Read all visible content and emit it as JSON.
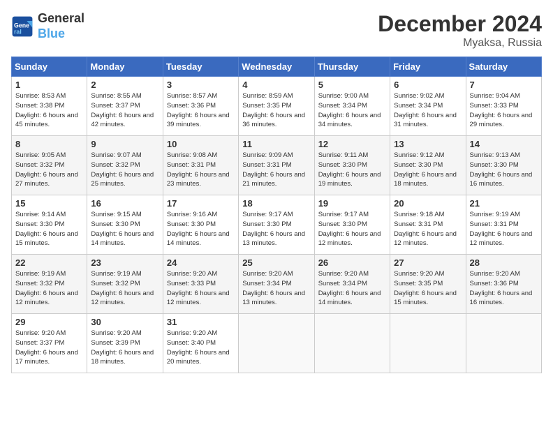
{
  "header": {
    "logo_line1": "General",
    "logo_line2": "Blue",
    "month": "December 2024",
    "location": "Myaksa, Russia"
  },
  "weekdays": [
    "Sunday",
    "Monday",
    "Tuesday",
    "Wednesday",
    "Thursday",
    "Friday",
    "Saturday"
  ],
  "weeks": [
    [
      {
        "day": "1",
        "sunrise": "Sunrise: 8:53 AM",
        "sunset": "Sunset: 3:38 PM",
        "daylight": "Daylight: 6 hours and 45 minutes."
      },
      {
        "day": "2",
        "sunrise": "Sunrise: 8:55 AM",
        "sunset": "Sunset: 3:37 PM",
        "daylight": "Daylight: 6 hours and 42 minutes."
      },
      {
        "day": "3",
        "sunrise": "Sunrise: 8:57 AM",
        "sunset": "Sunset: 3:36 PM",
        "daylight": "Daylight: 6 hours and 39 minutes."
      },
      {
        "day": "4",
        "sunrise": "Sunrise: 8:59 AM",
        "sunset": "Sunset: 3:35 PM",
        "daylight": "Daylight: 6 hours and 36 minutes."
      },
      {
        "day": "5",
        "sunrise": "Sunrise: 9:00 AM",
        "sunset": "Sunset: 3:34 PM",
        "daylight": "Daylight: 6 hours and 34 minutes."
      },
      {
        "day": "6",
        "sunrise": "Sunrise: 9:02 AM",
        "sunset": "Sunset: 3:34 PM",
        "daylight": "Daylight: 6 hours and 31 minutes."
      },
      {
        "day": "7",
        "sunrise": "Sunrise: 9:04 AM",
        "sunset": "Sunset: 3:33 PM",
        "daylight": "Daylight: 6 hours and 29 minutes."
      }
    ],
    [
      {
        "day": "8",
        "sunrise": "Sunrise: 9:05 AM",
        "sunset": "Sunset: 3:32 PM",
        "daylight": "Daylight: 6 hours and 27 minutes."
      },
      {
        "day": "9",
        "sunrise": "Sunrise: 9:07 AM",
        "sunset": "Sunset: 3:32 PM",
        "daylight": "Daylight: 6 hours and 25 minutes."
      },
      {
        "day": "10",
        "sunrise": "Sunrise: 9:08 AM",
        "sunset": "Sunset: 3:31 PM",
        "daylight": "Daylight: 6 hours and 23 minutes."
      },
      {
        "day": "11",
        "sunrise": "Sunrise: 9:09 AM",
        "sunset": "Sunset: 3:31 PM",
        "daylight": "Daylight: 6 hours and 21 minutes."
      },
      {
        "day": "12",
        "sunrise": "Sunrise: 9:11 AM",
        "sunset": "Sunset: 3:30 PM",
        "daylight": "Daylight: 6 hours and 19 minutes."
      },
      {
        "day": "13",
        "sunrise": "Sunrise: 9:12 AM",
        "sunset": "Sunset: 3:30 PM",
        "daylight": "Daylight: 6 hours and 18 minutes."
      },
      {
        "day": "14",
        "sunrise": "Sunrise: 9:13 AM",
        "sunset": "Sunset: 3:30 PM",
        "daylight": "Daylight: 6 hours and 16 minutes."
      }
    ],
    [
      {
        "day": "15",
        "sunrise": "Sunrise: 9:14 AM",
        "sunset": "Sunset: 3:30 PM",
        "daylight": "Daylight: 6 hours and 15 minutes."
      },
      {
        "day": "16",
        "sunrise": "Sunrise: 9:15 AM",
        "sunset": "Sunset: 3:30 PM",
        "daylight": "Daylight: 6 hours and 14 minutes."
      },
      {
        "day": "17",
        "sunrise": "Sunrise: 9:16 AM",
        "sunset": "Sunset: 3:30 PM",
        "daylight": "Daylight: 6 hours and 14 minutes."
      },
      {
        "day": "18",
        "sunrise": "Sunrise: 9:17 AM",
        "sunset": "Sunset: 3:30 PM",
        "daylight": "Daylight: 6 hours and 13 minutes."
      },
      {
        "day": "19",
        "sunrise": "Sunrise: 9:17 AM",
        "sunset": "Sunset: 3:30 PM",
        "daylight": "Daylight: 6 hours and 12 minutes."
      },
      {
        "day": "20",
        "sunrise": "Sunrise: 9:18 AM",
        "sunset": "Sunset: 3:31 PM",
        "daylight": "Daylight: 6 hours and 12 minutes."
      },
      {
        "day": "21",
        "sunrise": "Sunrise: 9:19 AM",
        "sunset": "Sunset: 3:31 PM",
        "daylight": "Daylight: 6 hours and 12 minutes."
      }
    ],
    [
      {
        "day": "22",
        "sunrise": "Sunrise: 9:19 AM",
        "sunset": "Sunset: 3:32 PM",
        "daylight": "Daylight: 6 hours and 12 minutes."
      },
      {
        "day": "23",
        "sunrise": "Sunrise: 9:19 AM",
        "sunset": "Sunset: 3:32 PM",
        "daylight": "Daylight: 6 hours and 12 minutes."
      },
      {
        "day": "24",
        "sunrise": "Sunrise: 9:20 AM",
        "sunset": "Sunset: 3:33 PM",
        "daylight": "Daylight: 6 hours and 12 minutes."
      },
      {
        "day": "25",
        "sunrise": "Sunrise: 9:20 AM",
        "sunset": "Sunset: 3:34 PM",
        "daylight": "Daylight: 6 hours and 13 minutes."
      },
      {
        "day": "26",
        "sunrise": "Sunrise: 9:20 AM",
        "sunset": "Sunset: 3:34 PM",
        "daylight": "Daylight: 6 hours and 14 minutes."
      },
      {
        "day": "27",
        "sunrise": "Sunrise: 9:20 AM",
        "sunset": "Sunset: 3:35 PM",
        "daylight": "Daylight: 6 hours and 15 minutes."
      },
      {
        "day": "28",
        "sunrise": "Sunrise: 9:20 AM",
        "sunset": "Sunset: 3:36 PM",
        "daylight": "Daylight: 6 hours and 16 minutes."
      }
    ],
    [
      {
        "day": "29",
        "sunrise": "Sunrise: 9:20 AM",
        "sunset": "Sunset: 3:37 PM",
        "daylight": "Daylight: 6 hours and 17 minutes."
      },
      {
        "day": "30",
        "sunrise": "Sunrise: 9:20 AM",
        "sunset": "Sunset: 3:39 PM",
        "daylight": "Daylight: 6 hours and 18 minutes."
      },
      {
        "day": "31",
        "sunrise": "Sunrise: 9:20 AM",
        "sunset": "Sunset: 3:40 PM",
        "daylight": "Daylight: 6 hours and 20 minutes."
      },
      null,
      null,
      null,
      null
    ]
  ]
}
